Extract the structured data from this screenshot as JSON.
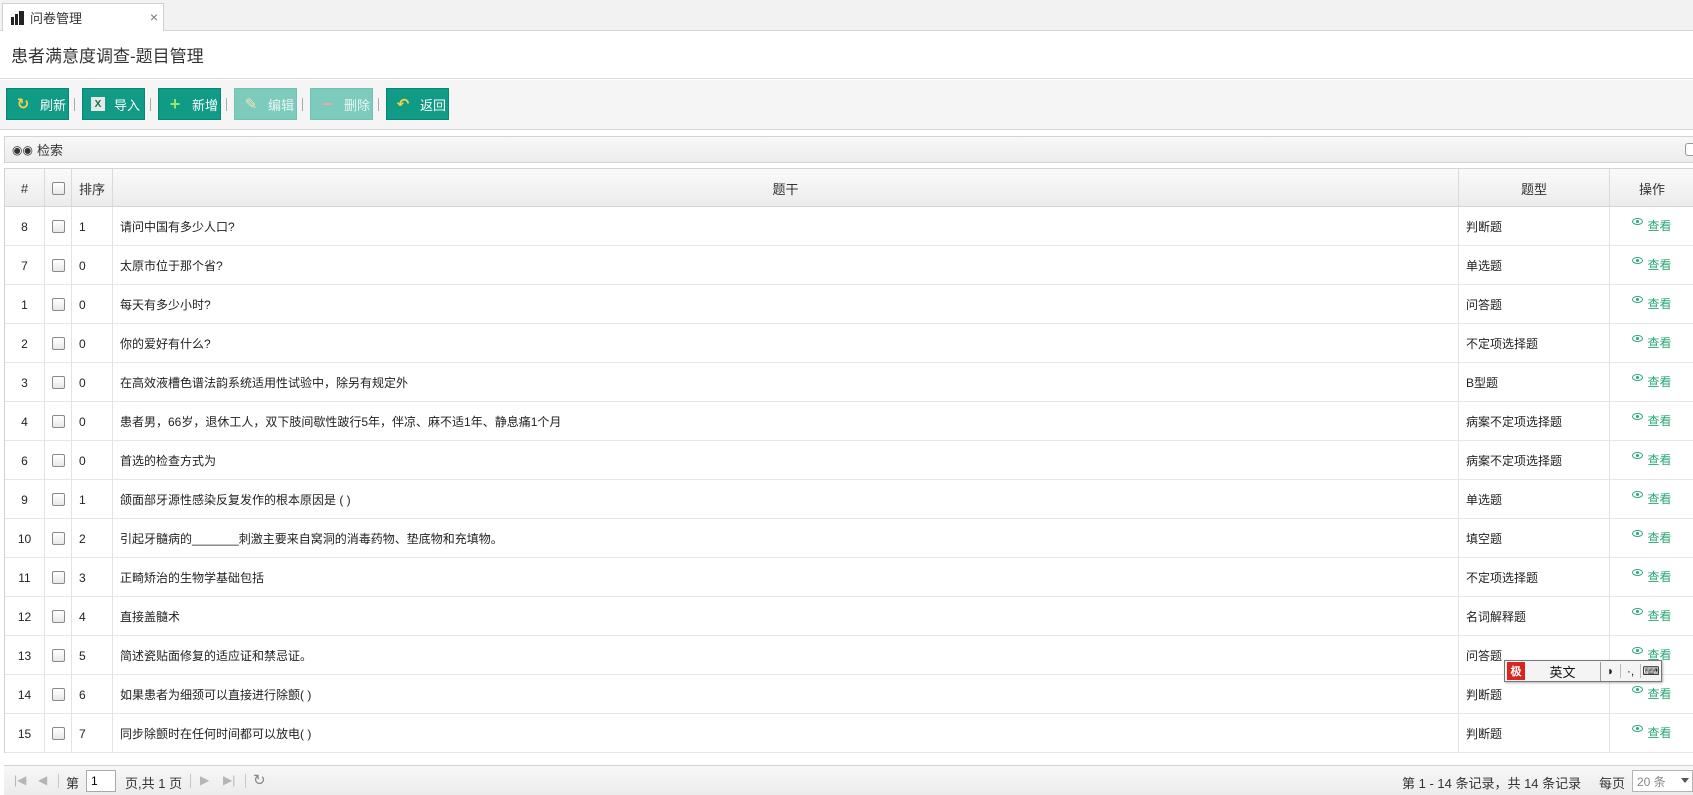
{
  "tab": {
    "label": "问卷管理",
    "close": "×"
  },
  "page_title": "患者满意度调查-题目管理",
  "toolbar": {
    "refresh": "刷新",
    "import": "导入",
    "add": "新增",
    "edit": "编辑",
    "delete": "删除",
    "back": "返回"
  },
  "search": {
    "label": "检索"
  },
  "grid": {
    "headers": {
      "num": "#",
      "order": "排序",
      "title": "题干",
      "type": "题型",
      "op": "操作"
    },
    "rows": [
      {
        "num": "8",
        "order": "1",
        "title": "请问中国有多少人口?",
        "type": "判断题",
        "op": "查看"
      },
      {
        "num": "7",
        "order": "0",
        "title": "太原市位于那个省?",
        "type": "单选题",
        "op": "查看"
      },
      {
        "num": "1",
        "order": "0",
        "title": "每天有多少小时?",
        "type": "问答题",
        "op": "查看"
      },
      {
        "num": "2",
        "order": "0",
        "title": "你的爱好有什么?",
        "type": "不定项选择题",
        "op": "查看"
      },
      {
        "num": "3",
        "order": "0",
        "title": "在高效液槽色谱法韵系统适用性试验中，除另有规定外",
        "type": "B型题",
        "op": "查看"
      },
      {
        "num": "4",
        "order": "0",
        "title": "患者男，66岁，退休工人，双下肢间歇性跛行5年，伴凉、麻不适1年、静息痛1个月",
        "type": "病案不定项选择题",
        "op": "查看"
      },
      {
        "num": "6",
        "order": "0",
        "title": "首选的检查方式为",
        "type": "病案不定项选择题",
        "op": "查看"
      },
      {
        "num": "9",
        "order": "1",
        "title": "颌面部牙源性感染反复发作的根本原因是 ( )",
        "type": "单选题",
        "op": "查看"
      },
      {
        "num": "10",
        "order": "2",
        "title": "引起牙髓病的_______刺激主要来自窝洞的消毒药物、垫底物和充填物。",
        "type": "填空题",
        "op": "查看"
      },
      {
        "num": "11",
        "order": "3",
        "title": "正畸矫治的生物学基础包括",
        "type": "不定项选择题",
        "op": "查看"
      },
      {
        "num": "12",
        "order": "4",
        "title": "直接盖髓术",
        "type": "名词解释题",
        "op": "查看"
      },
      {
        "num": "13",
        "order": "5",
        "title": "简述瓷贴面修复的适应证和禁忌证。",
        "type": "问答题",
        "op": "查看"
      },
      {
        "num": "14",
        "order": "6",
        "title": "如果患者为细颈可以直接进行除颤( )",
        "type": "判断题",
        "op": "查看"
      },
      {
        "num": "15",
        "order": "7",
        "title": "同步除颤时在任何时间都可以放电( )",
        "type": "判断题",
        "op": "查看"
      }
    ]
  },
  "pager": {
    "page_prefix": "第",
    "page_value": "1",
    "page_suffix": "页,共 1 页",
    "records": "第 1 - 14 条记录，共 14 条记录",
    "per_page_label": "每页",
    "per_page_value": "20 条"
  },
  "ime": {
    "logo": "极",
    "lang": "英文",
    "moon": "◗",
    "dots": "·,",
    "kb": "⌨"
  },
  "colors": {
    "primary": "#0f9b85",
    "disabled": "#7dcbbd",
    "link": "#2aa876"
  }
}
